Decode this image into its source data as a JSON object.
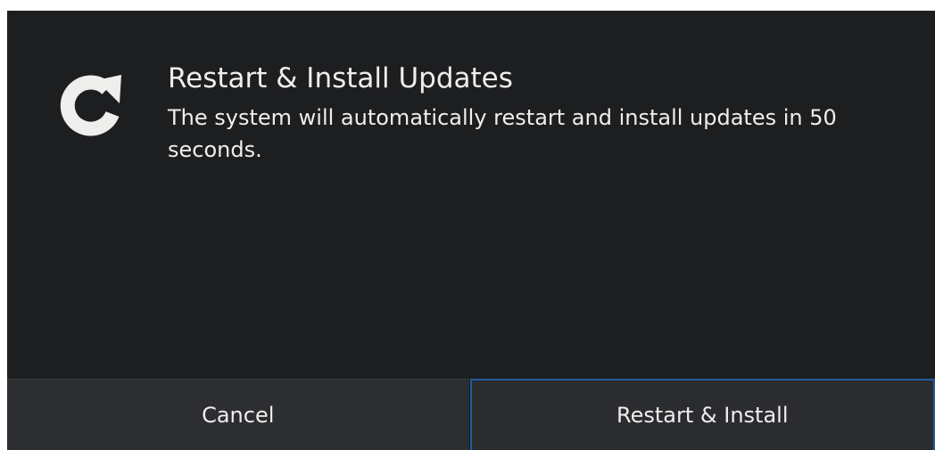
{
  "dialog": {
    "icon": "restart-icon",
    "title": "Restart & Install Updates",
    "message": "The system will automatically restart and install updates in 50 seconds."
  },
  "buttons": {
    "cancel_label": "Cancel",
    "confirm_label": "Restart & Install"
  },
  "colors": {
    "background": "#1d1e20",
    "button_bg": "#2c2e31",
    "text": "#eeeeec",
    "focus_border": "#1f5c9e"
  }
}
